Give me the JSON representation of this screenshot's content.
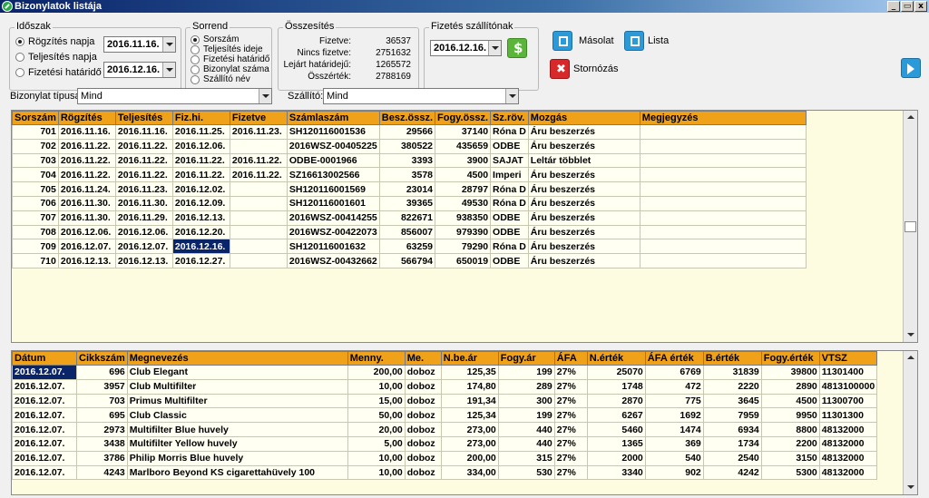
{
  "window": {
    "title": "Bizonylatok listája",
    "buttons": [
      "_",
      "▭",
      "x"
    ]
  },
  "idoszak": {
    "title": "Időszak",
    "options": [
      "Rögzítés napja",
      "Teljesítés napja",
      "Fizetési határidő"
    ],
    "selected": 0,
    "date_from": "2016.11.16.",
    "date_to": "2016.12.16."
  },
  "sorrend": {
    "title": "Sorrend",
    "options": [
      "Sorszám",
      "Teljesítés ideje",
      "Fizetési határidő",
      "Bizonylat száma",
      "Szállító név"
    ],
    "selected": 0
  },
  "osszesites": {
    "title": "Összesítés",
    "rows": [
      {
        "label": "Fizetve:",
        "value": "36537"
      },
      {
        "label": "Nincs fizetve:",
        "value": "2751632"
      },
      {
        "label": "Lejárt határidejű:",
        "value": "1265572"
      },
      {
        "label": "Összérték:",
        "value": "2788169"
      }
    ]
  },
  "fizetes": {
    "title": "Fizetés szállítónak",
    "date": "2016.12.16."
  },
  "actions": {
    "masolat": "Másolat",
    "lista": "Lista",
    "stornozas": "Stornózás"
  },
  "filters": {
    "type_label": "Bizonylat típusa:",
    "type_value": "Mind",
    "supplier_label": "Szállító:",
    "supplier_value": "Mind"
  },
  "colors": {
    "header": "#f0a11a",
    "row": "#fffff2",
    "selected": "#0a246a"
  },
  "upper_grid": {
    "columns": [
      "Sorszám",
      "Rögzítés",
      "Teljesítés",
      "Fiz.hi.",
      "Fizetve",
      "Számlaszám",
      "Besz.össz.",
      "Fogy.össz.",
      "Sz.röv.",
      "Mozgás",
      "Megjegyzés"
    ],
    "rows": [
      [
        "701",
        "2016.11.16.",
        "2016.11.16.",
        "2016.11.25.",
        "2016.11.23.",
        "SH120116001536",
        "29566",
        "37140",
        "Róna D",
        "Áru beszerzés",
        ""
      ],
      [
        "702",
        "2016.11.22.",
        "2016.11.22.",
        "2016.12.06.",
        "",
        "2016WSZ-00405225",
        "380522",
        "435659",
        "ODBE",
        "Áru beszerzés",
        ""
      ],
      [
        "703",
        "2016.11.22.",
        "2016.11.22.",
        "2016.11.22.",
        "2016.11.22.",
        "ODBE-0001966",
        "3393",
        "3900",
        "SAJAT",
        "Leltár többlet",
        ""
      ],
      [
        "704",
        "2016.11.22.",
        "2016.11.22.",
        "2016.11.22.",
        "2016.11.22.",
        "SZ16613002566",
        "3578",
        "4500",
        "Imperi",
        "Áru beszerzés",
        ""
      ],
      [
        "705",
        "2016.11.24.",
        "2016.11.23.",
        "2016.12.02.",
        "",
        "SH120116001569",
        "23014",
        "28797",
        "Róna D",
        "Áru beszerzés",
        ""
      ],
      [
        "706",
        "2016.11.30.",
        "2016.11.30.",
        "2016.12.09.",
        "",
        "SH120116001601",
        "39365",
        "49530",
        "Róna D",
        "Áru beszerzés",
        ""
      ],
      [
        "707",
        "2016.11.30.",
        "2016.11.29.",
        "2016.12.13.",
        "",
        "2016WSZ-00414255",
        "822671",
        "938350",
        "ODBE",
        "Áru beszerzés",
        ""
      ],
      [
        "708",
        "2016.12.06.",
        "2016.12.06.",
        "2016.12.20.",
        "",
        "2016WSZ-00422073",
        "856007",
        "979390",
        "ODBE",
        "Áru beszerzés",
        ""
      ],
      [
        "709",
        "2016.12.07.",
        "2016.12.07.",
        "2016.12.16.",
        "",
        "SH120116001632",
        "63259",
        "79290",
        "Róna D",
        "Áru beszerzés",
        ""
      ],
      [
        "710",
        "2016.12.13.",
        "2016.12.13.",
        "2016.12.27.",
        "",
        "2016WSZ-00432662",
        "566794",
        "650019",
        "ODBE",
        "Áru beszerzés",
        ""
      ]
    ]
  },
  "lower_grid": {
    "columns": [
      "Dátum",
      "Cikkszám",
      "Megnevezés",
      "Menny.",
      "Me.",
      "N.be.ár",
      "Fogy.ár",
      "ÁFA",
      "N.érték",
      "ÁFA érték",
      "B.érték",
      "Fogy.érték",
      "VTSZ"
    ],
    "rows": [
      [
        "2016.12.07.",
        "696",
        "Club Elegant",
        "200,00",
        "doboz",
        "125,35",
        "199",
        "27%",
        "25070",
        "6769",
        "31839",
        "39800",
        "11301400"
      ],
      [
        "2016.12.07.",
        "3957",
        "Club Multifilter",
        "10,00",
        "doboz",
        "174,80",
        "289",
        "27%",
        "1748",
        "472",
        "2220",
        "2890",
        "4813100000"
      ],
      [
        "2016.12.07.",
        "703",
        "Primus Multifilter",
        "15,00",
        "doboz",
        "191,34",
        "300",
        "27%",
        "2870",
        "775",
        "3645",
        "4500",
        "11300700"
      ],
      [
        "2016.12.07.",
        "695",
        "Club Classic",
        "50,00",
        "doboz",
        "125,34",
        "199",
        "27%",
        "6267",
        "1692",
        "7959",
        "9950",
        "11301300"
      ],
      [
        "2016.12.07.",
        "2973",
        "Multifilter Blue huvely",
        "20,00",
        "doboz",
        "273,00",
        "440",
        "27%",
        "5460",
        "1474",
        "6934",
        "8800",
        "48132000"
      ],
      [
        "2016.12.07.",
        "3438",
        "Multifilter Yellow huvely",
        "5,00",
        "doboz",
        "273,00",
        "440",
        "27%",
        "1365",
        "369",
        "1734",
        "2200",
        "48132000"
      ],
      [
        "2016.12.07.",
        "3786",
        "Philip Morris Blue huvely",
        "10,00",
        "doboz",
        "200,00",
        "315",
        "27%",
        "2000",
        "540",
        "2540",
        "3150",
        "48132000"
      ],
      [
        "2016.12.07.",
        "4243",
        "Marlboro Beyond KS cigarettahüvely 100",
        "10,00",
        "doboz",
        "334,00",
        "530",
        "27%",
        "3340",
        "902",
        "4242",
        "5300",
        "48132000"
      ]
    ]
  }
}
